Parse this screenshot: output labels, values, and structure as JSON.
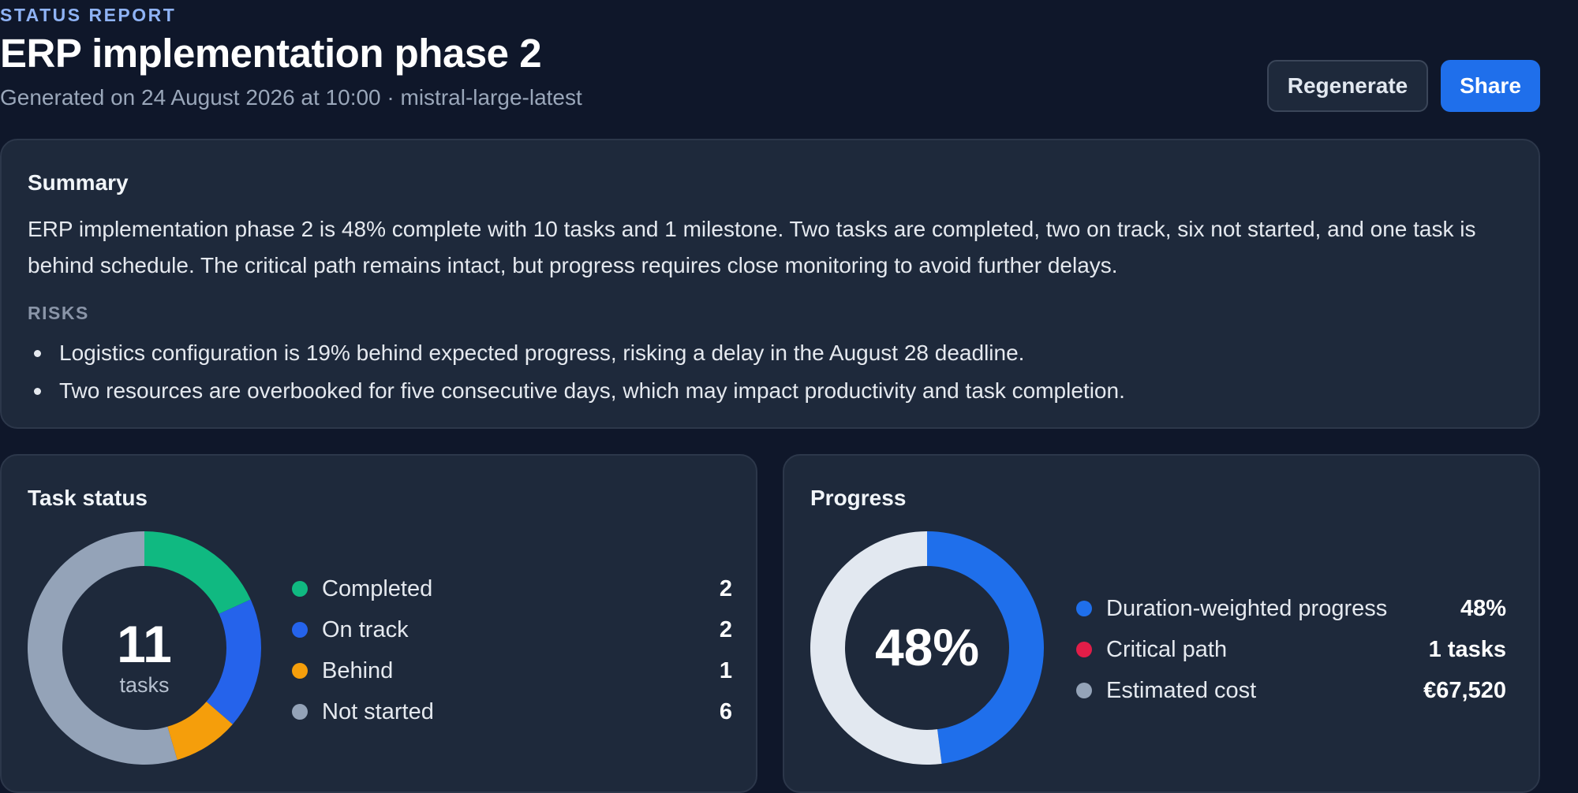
{
  "header": {
    "eyebrow": "STATUS REPORT",
    "title": "ERP implementation phase 2",
    "subtitle": "Generated on 24 August 2026 at 10:00 · mistral-large-latest",
    "regenerate_label": "Regenerate",
    "share_label": "Share"
  },
  "summary": {
    "heading": "Summary",
    "text": "ERP implementation phase 2 is 48% complete with 10 tasks and 1 milestone. Two tasks are completed, two on track, six not started, and one task is behind schedule. The critical path remains intact, but progress requires close monitoring to avoid further delays.",
    "risks_label": "RISKS",
    "risks": [
      "Logistics configuration is 19% behind expected progress, risking a delay in the August 28 deadline.",
      "Two resources are overbooked for five consecutive days, which may impact productivity and task completion."
    ]
  },
  "task_status": {
    "heading": "Task status",
    "total": "11",
    "total_label": "tasks",
    "items": [
      {
        "label": "Completed",
        "value": "2",
        "count": 2,
        "color": "#10b981"
      },
      {
        "label": "On track",
        "value": "2",
        "count": 2,
        "color": "#2563eb"
      },
      {
        "label": "Behind",
        "value": "1",
        "count": 1,
        "color": "#f59e0b"
      },
      {
        "label": "Not started",
        "value": "6",
        "count": 6,
        "color": "#94a3b8"
      }
    ]
  },
  "progress": {
    "heading": "Progress",
    "center": "48%",
    "fraction": 0.48,
    "fill_color": "#1f6feb",
    "track_color": "#e2e8f0",
    "items": [
      {
        "label": "Duration-weighted progress",
        "value": "48%",
        "color": "#1f6feb"
      },
      {
        "label": "Critical path",
        "value": "1 tasks",
        "color": "#e11d48"
      },
      {
        "label": "Estimated cost",
        "value": "€67,520",
        "color": "#94a3b8"
      }
    ]
  }
}
